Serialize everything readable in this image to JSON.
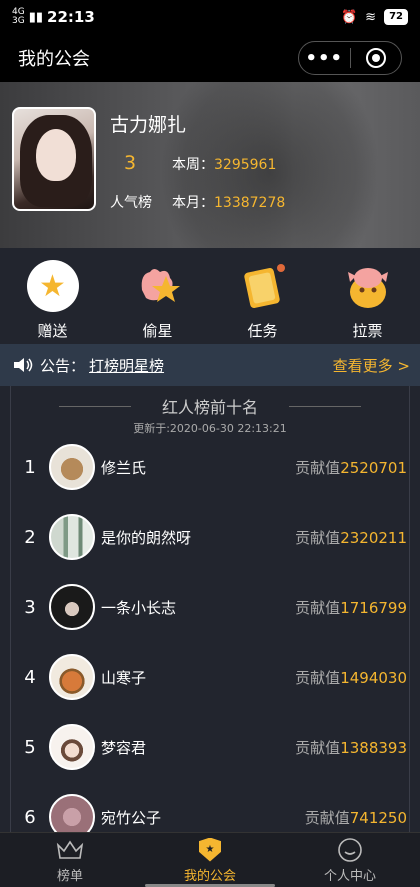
{
  "statusbar": {
    "sig1": "4G",
    "sig2": "3G",
    "time": "22:13",
    "battery": "72"
  },
  "navbar": {
    "title": "我的公会"
  },
  "hero": {
    "name": "古力娜扎",
    "rank": "3",
    "rank_label": "人气榜",
    "week_label": "本周：",
    "week_value": "3295961",
    "month_label": "本月：",
    "month_value": "13387278"
  },
  "actions": [
    {
      "label": "赠送",
      "icon": "star-icon"
    },
    {
      "label": "偷星",
      "icon": "hand-star-icon"
    },
    {
      "label": "任务",
      "icon": "book-icon"
    },
    {
      "label": "拉票",
      "icon": "pig-icon"
    }
  ],
  "notice": {
    "prefix": "公告：",
    "link": "打榜明星榜",
    "more": "查看更多 >"
  },
  "board": {
    "title": "红人榜前十名",
    "updated": "更新于:2020-06-30 22:13:21",
    "score_label": "贡献值",
    "rows": [
      {
        "rank": "1",
        "name": "修兰氏",
        "score": "2520701"
      },
      {
        "rank": "2",
        "name": "是你的朗然呀",
        "score": "2320211"
      },
      {
        "rank": "3",
        "name": "一条小长志",
        "score": "1716799"
      },
      {
        "rank": "4",
        "name": "山寒子",
        "score": "1494030"
      },
      {
        "rank": "5",
        "name": "梦容君",
        "score": "1388393"
      },
      {
        "rank": "6",
        "name": "宛竹公子",
        "score": "741250"
      }
    ]
  },
  "tabbar": [
    {
      "label": "榜单",
      "icon": "crown-icon"
    },
    {
      "label": "我的公会",
      "icon": "shield-icon"
    },
    {
      "label": "个人中心",
      "icon": "smile-icon"
    }
  ],
  "colors": {
    "accent": "#f5b630",
    "background": "#22252e",
    "notice_bg": "#2f3a4a"
  }
}
